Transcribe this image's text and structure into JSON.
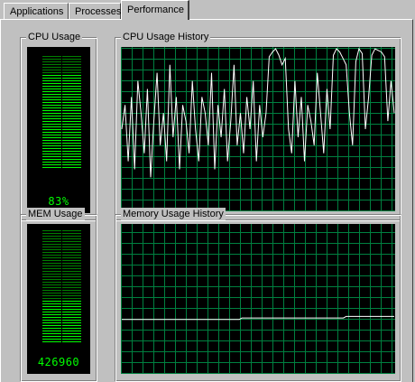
{
  "tabs": [
    "Applications",
    "Processes",
    "Performance"
  ],
  "active_tab": 2,
  "cpu_usage": {
    "label": "CPU Usage",
    "value_text": "83%",
    "level": 0.83
  },
  "cpu_history": {
    "label": "CPU Usage History",
    "line_color": "#ffffff",
    "values": [
      50,
      65,
      30,
      70,
      25,
      80,
      60,
      35,
      75,
      20,
      55,
      85,
      40,
      60,
      30,
      90,
      45,
      70,
      25,
      65,
      55,
      35,
      80,
      50,
      30,
      70,
      60,
      40,
      85,
      25,
      65,
      45,
      75,
      30,
      55,
      90,
      40,
      60,
      35,
      70,
      50,
      80,
      30,
      65,
      45,
      60,
      95,
      98,
      100,
      96,
      90,
      94,
      50,
      35,
      80,
      45,
      70,
      30,
      65,
      55,
      40,
      85,
      60,
      35,
      75,
      50,
      96,
      100,
      98,
      94,
      90,
      60,
      40,
      92,
      100,
      97,
      50,
      70,
      96,
      100,
      99,
      98,
      95,
      55,
      80,
      60
    ]
  },
  "mem_usage": {
    "label": "MEM Usage",
    "value_text": "426960",
    "level": 0.38
  },
  "mem_history": {
    "label": "Memory Usage History",
    "line_color": "#ffffff",
    "values": [
      36,
      36,
      36,
      36,
      36,
      36,
      36,
      36,
      36,
      36,
      36,
      36,
      36,
      36,
      36,
      36,
      36,
      36,
      36,
      36,
      36,
      36,
      36,
      36,
      36,
      36,
      36,
      36,
      36,
      36,
      36,
      36,
      36,
      36,
      36,
      36,
      36,
      36,
      36,
      36,
      36,
      36,
      36,
      36,
      36,
      37,
      37,
      37,
      37,
      37,
      37,
      37,
      37,
      37,
      37,
      37,
      37,
      37,
      37,
      37,
      37,
      37,
      37,
      37,
      37,
      37,
      37,
      37,
      37,
      37,
      37,
      37,
      37,
      37,
      37,
      37,
      37,
      37,
      37,
      37,
      37,
      37,
      37,
      37,
      38,
      38,
      38,
      38,
      38,
      38,
      38,
      38,
      38,
      38,
      38,
      38,
      38,
      38,
      38,
      38,
      38,
      38,
      38
    ]
  },
  "colors": {
    "grid": "#008040",
    "meter_on": "#00ff00",
    "meter_off": "#008000"
  }
}
